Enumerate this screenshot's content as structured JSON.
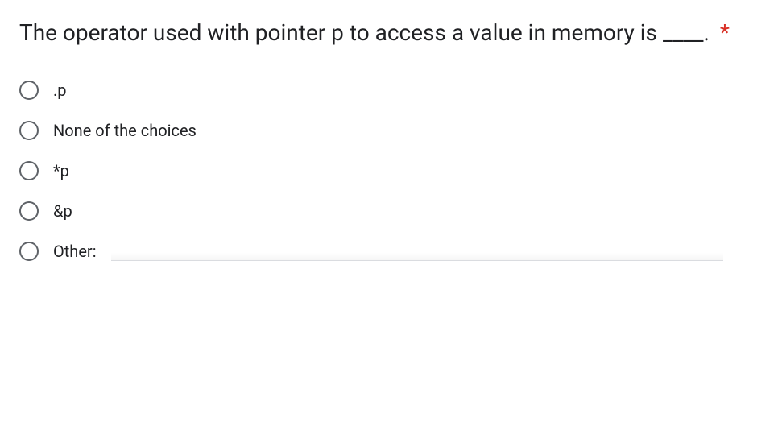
{
  "question": {
    "text": "The operator used with pointer p to access a value in memory is ____.",
    "required_marker": "*"
  },
  "options": [
    {
      "label": ".p"
    },
    {
      "label": "None of the choices"
    },
    {
      "label": "*p"
    },
    {
      "label": "&p"
    }
  ],
  "other": {
    "label": "Other:",
    "value": ""
  }
}
